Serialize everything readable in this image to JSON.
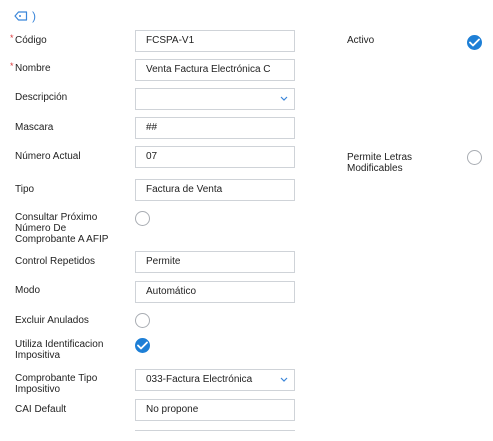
{
  "header": {
    "tag_icon": "tag-icon",
    "paren": ")"
  },
  "colors": {
    "accent": "#1e7fd6",
    "required": "#d9383a",
    "border": "#cfd3d8"
  },
  "fields": {
    "codigo": {
      "label": "Código",
      "required": "*",
      "value": "FCSPA-V1"
    },
    "nombre": {
      "label": "Nombre",
      "required": "*",
      "value": "Venta Factura Electrónica C"
    },
    "descripcion": {
      "label": "Descripción",
      "value": ""
    },
    "mascara": {
      "label": "Mascara",
      "value": "##"
    },
    "numero_actual": {
      "label": "Número Actual",
      "value": "07"
    },
    "tipo": {
      "label": "Tipo",
      "value": "Factura de Venta"
    },
    "consultar": {
      "label_lines": [
        "Consultar Próximo",
        "Número De",
        "Comprobante A AFIP"
      ],
      "checked": false
    },
    "control_repetidos": {
      "label": "Control Repetidos",
      "value": "Permite"
    },
    "modo": {
      "label": "Modo",
      "value": "Automático"
    },
    "excluir_anulados": {
      "label": "Excluir Anulados",
      "checked": false
    },
    "utiliza_identificacion": {
      "label_lines": [
        "Utiliza Identificacion",
        "Impositiva"
      ],
      "checked": true
    },
    "comprobante_tipo": {
      "label_lines": [
        "Comprobante Tipo",
        "Impositivo"
      ],
      "value": "033-Factura Electrónica"
    },
    "cai_default": {
      "label": "CAI Default",
      "value": "No propone"
    }
  },
  "right": {
    "activo": {
      "label": "Activo",
      "checked": true
    },
    "permite_letras": {
      "label_lines": [
        "Permite Letras",
        "Modificables"
      ],
      "checked": false
    }
  }
}
